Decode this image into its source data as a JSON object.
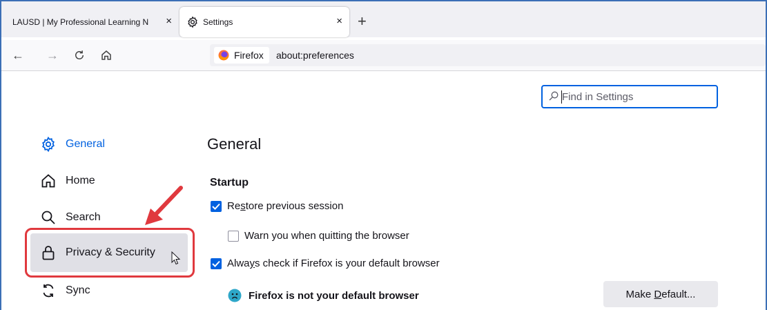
{
  "tabs": [
    {
      "label": "LAUSD | My Professional Learning N",
      "close": "×"
    },
    {
      "label": "Settings",
      "close": "×"
    }
  ],
  "new_tab": "+",
  "nav": {
    "back": "←",
    "forward": "→"
  },
  "urlbar": {
    "identity_label": "Firefox",
    "url": "about:preferences"
  },
  "search": {
    "placeholder": "Find in Settings"
  },
  "sidebar": {
    "items": [
      {
        "label": "General",
        "icon": "gear-icon",
        "selected": true
      },
      {
        "label": "Home",
        "icon": "home-icon"
      },
      {
        "label": "Search",
        "icon": "search-icon"
      },
      {
        "label": "Privacy & Security",
        "icon": "lock-icon"
      },
      {
        "label": "Sync",
        "icon": "sync-icon"
      }
    ]
  },
  "main": {
    "title": "General",
    "startup": {
      "heading": "Startup",
      "restore_prefix": "Re",
      "restore_access": "s",
      "restore_suffix": "tore previous session",
      "warn_label": "Warn you when quitting the browser",
      "always_prefix": "Alwa",
      "always_access": "y",
      "always_suffix": "s check if Firefox is your default browser",
      "restore_checked": true,
      "warn_checked": false,
      "always_checked": true
    },
    "default_status": "Firefox is not your default browser",
    "make_default_prefix": "Make ",
    "make_default_access": "D",
    "make_default_suffix": "efault..."
  },
  "colors": {
    "accent": "#0061e0",
    "annotation": "#e0393e",
    "border": "#3b6fb6"
  }
}
